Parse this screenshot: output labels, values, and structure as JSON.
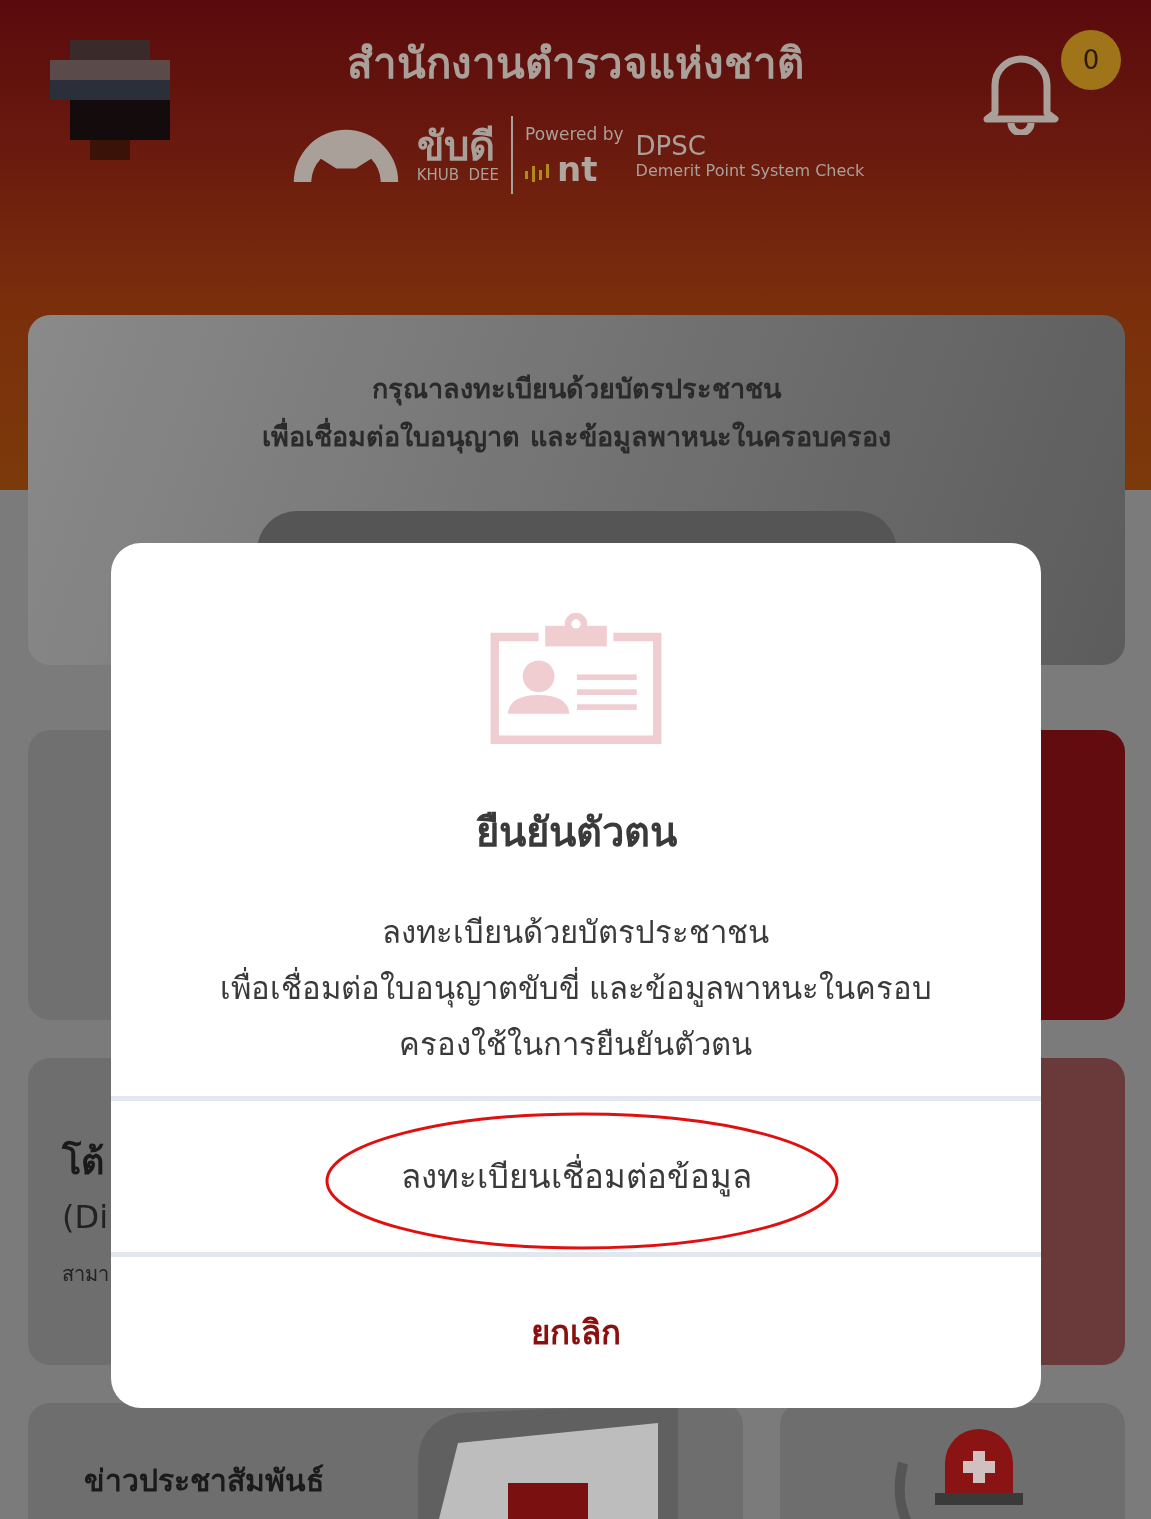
{
  "header": {
    "title": "สำนักงานตำรวจแห่งชาติ",
    "notification_count": "0",
    "logo_name": "ขับดี",
    "logo_subtitle": "KHUB  DEE",
    "powered_by": "Powered by",
    "brand_mark": "nt",
    "product": "DPSC",
    "product_full": "Demerit Point System Check"
  },
  "register_card": {
    "lines": [
      "กรุณาลงทะเบียนด้วยบัตรประชาชน",
      "เพื่อเชื่อมต่อใบอนุญาต และข้อมูลพาหนะในครอบครอง"
    ]
  },
  "dispute_card": {
    "title": "โต้",
    "subtitle": "(Di",
    "text": "สามา"
  },
  "news_card": {
    "title": "ข่าวประชาสัมพันธ์"
  },
  "dialog": {
    "title": "ยืนยันตัวตน",
    "message": [
      "ลงทะเบียนด้วยบัตรประชาชน",
      "เพื่อเชื่อมต่อใบอนุญาตขับขี่ และข้อมูลพาหนะในครอบ",
      "ครองใช้ในการยืนยันตัวตน"
    ],
    "actions": [
      {
        "label": "ลงทะเบียนเชื่อมต่อข้อมูล",
        "kind": "primary",
        "highlighted": true
      },
      {
        "label": "ยกเลิก",
        "kind": "cancel",
        "highlighted": false
      }
    ]
  }
}
